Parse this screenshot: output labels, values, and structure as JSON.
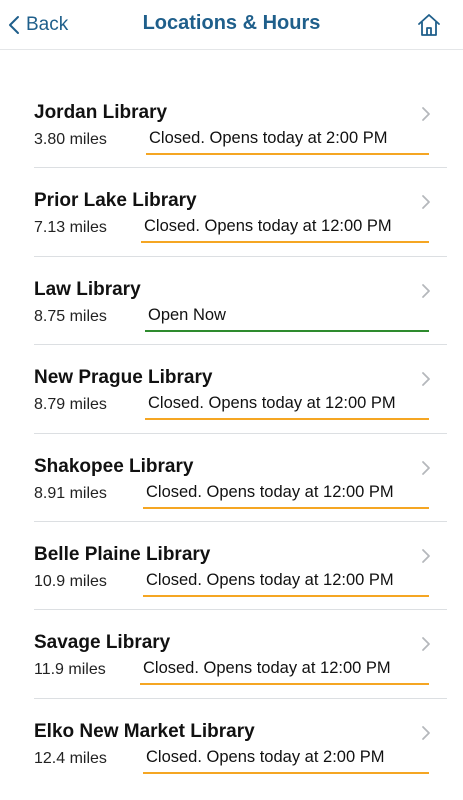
{
  "nav": {
    "back_label": "Back",
    "title": "Locations & Hours",
    "home_icon": "home-icon"
  },
  "colors": {
    "accent": "#1f5f8b",
    "closed": "#f5a623",
    "open": "#2e8b2e"
  },
  "locations": [
    {
      "name": "Jordan Library",
      "distance": "3.80 miles",
      "status": "Closed. Opens today at 2:00 PM",
      "state": "closed"
    },
    {
      "name": "Prior Lake Library",
      "distance": "7.13 miles",
      "status": "Closed. Opens today at 12:00 PM",
      "state": "closed"
    },
    {
      "name": "Law Library",
      "distance": "8.75 miles",
      "status": "Open Now",
      "state": "open"
    },
    {
      "name": "New Prague Library",
      "distance": "8.79 miles",
      "status": "Closed. Opens today at 12:00 PM",
      "state": "closed"
    },
    {
      "name": "Shakopee Library",
      "distance": "8.91 miles",
      "status": "Closed. Opens today at 12:00 PM",
      "state": "closed"
    },
    {
      "name": "Belle Plaine Library",
      "distance": "10.9 miles",
      "status": "Closed. Opens today at 12:00 PM",
      "state": "closed"
    },
    {
      "name": "Savage Library",
      "distance": "11.9 miles",
      "status": "Closed. Opens today at 12:00 PM",
      "state": "closed"
    },
    {
      "name": "Elko New Market Library",
      "distance": "12.4 miles",
      "status": "Closed. Opens today at 2:00 PM",
      "state": "closed"
    }
  ]
}
